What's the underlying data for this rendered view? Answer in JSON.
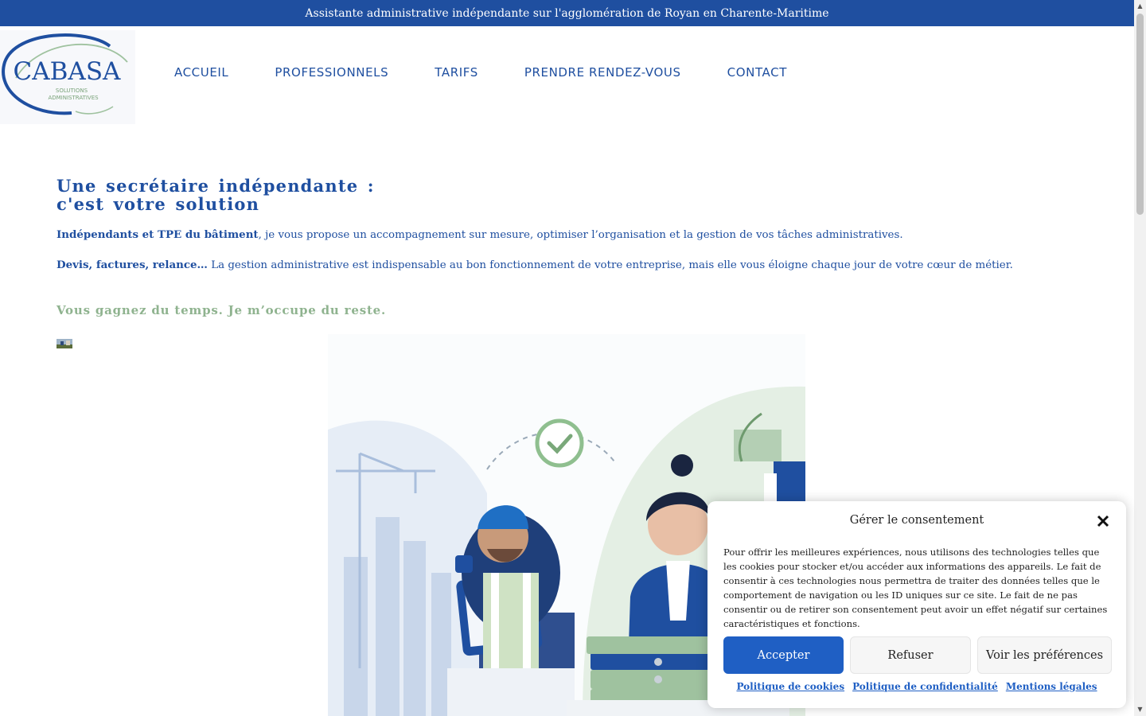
{
  "topbar": {
    "text": "Assistante administrative indépendante sur l'agglomération de Royan en Charente-Maritime"
  },
  "logo": {
    "name": "CABASA",
    "sub1": "SOLUTIONS",
    "sub2": "ADMINISTRATIVES"
  },
  "nav": {
    "items": [
      "ACCUEIL",
      "PROFESSIONNELS",
      "TARIFS",
      "PRENDRE RENDEZ-VOUS",
      "CONTACT"
    ]
  },
  "main": {
    "heading_line1": "Une secrétaire indépendante :",
    "heading_line2": "c'est votre solution",
    "p1_bold": "Indépendants et TPE du bâtiment",
    "p1_rest": ", je vous propose un accompagnement sur mesure, optimiser l’organisation et la gestion de vos tâches administratives.",
    "p2_bold": "Devis, factures, relance…",
    "p2_rest": " La gestion administrative est indispensable au bon fonctionnement de votre entreprise, mais elle vous éloigne chaque jour de votre cœur de métier.",
    "tagline": "Vous gagnez du temps. Je m’occupe du reste."
  },
  "consent": {
    "title": "Gérer le consentement",
    "text": "Pour offrir les meilleures expériences, nous utilisons des technologies telles que les cookies pour stocker et/ou accéder aux informations des appareils. Le fait de consentir à ces technologies nous permettra de traiter des données telles que le comportement de navigation ou les ID uniques sur ce site. Le fait de ne pas consentir ou de retirer son consentement peut avoir un effet négatif sur certaines caractéristiques et fonctions.",
    "accept": "Accepter",
    "refuse": "Refuser",
    "prefs": "Voir les préférences",
    "links": [
      "Politique de cookies",
      "Politique de confidentialité",
      "Mentions légales"
    ]
  },
  "colors": {
    "brand": "#1f4fa0",
    "accent_green": "#8fb38f",
    "button_blue": "#1f5fc4"
  },
  "icons": [
    "close-icon",
    "check-circle-icon"
  ]
}
